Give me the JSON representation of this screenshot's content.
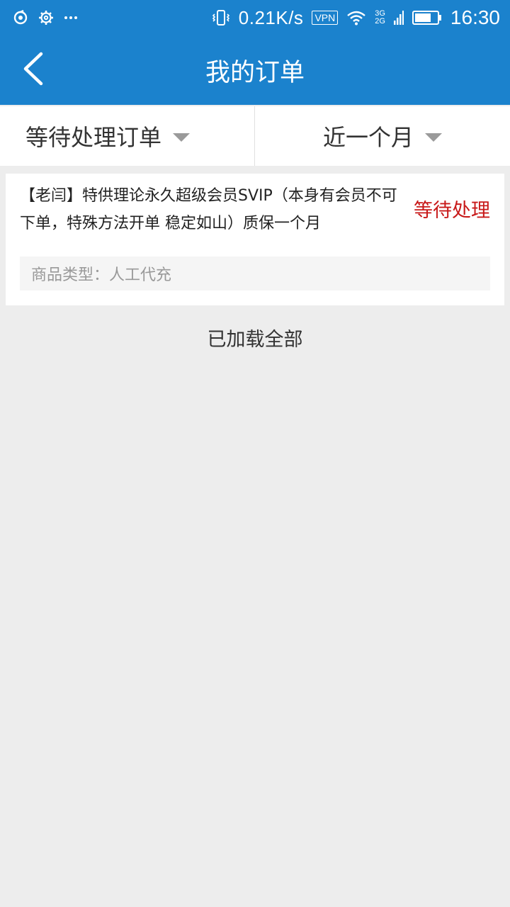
{
  "status_bar": {
    "net_speed": "0.21K/s",
    "vpn": "VPN",
    "net_3g": "3G",
    "net_2g": "2G",
    "time": "16:30",
    "icons": [
      "sync-icon",
      "gear-icon",
      "more-icon",
      "vibrate-icon",
      "wifi-icon",
      "signal-icon",
      "battery-icon"
    ]
  },
  "header": {
    "title": "我的订单",
    "back_icon": "chevron-left-icon"
  },
  "filters": {
    "status_label": "等待处理订单",
    "period_label": "近一个月"
  },
  "orders": [
    {
      "title": "【老闫】特供理论永久超级会员SVIP（本身有会员不可下单，特殊方法开单 稳定如山）质保一个月",
      "status": "等待处理",
      "type_label": "商品类型：人工代充"
    }
  ],
  "footer": {
    "loaded_all": "已加载全部"
  },
  "colors": {
    "primary": "#1b82cd",
    "status_red": "#c81919",
    "background": "#ededed"
  }
}
